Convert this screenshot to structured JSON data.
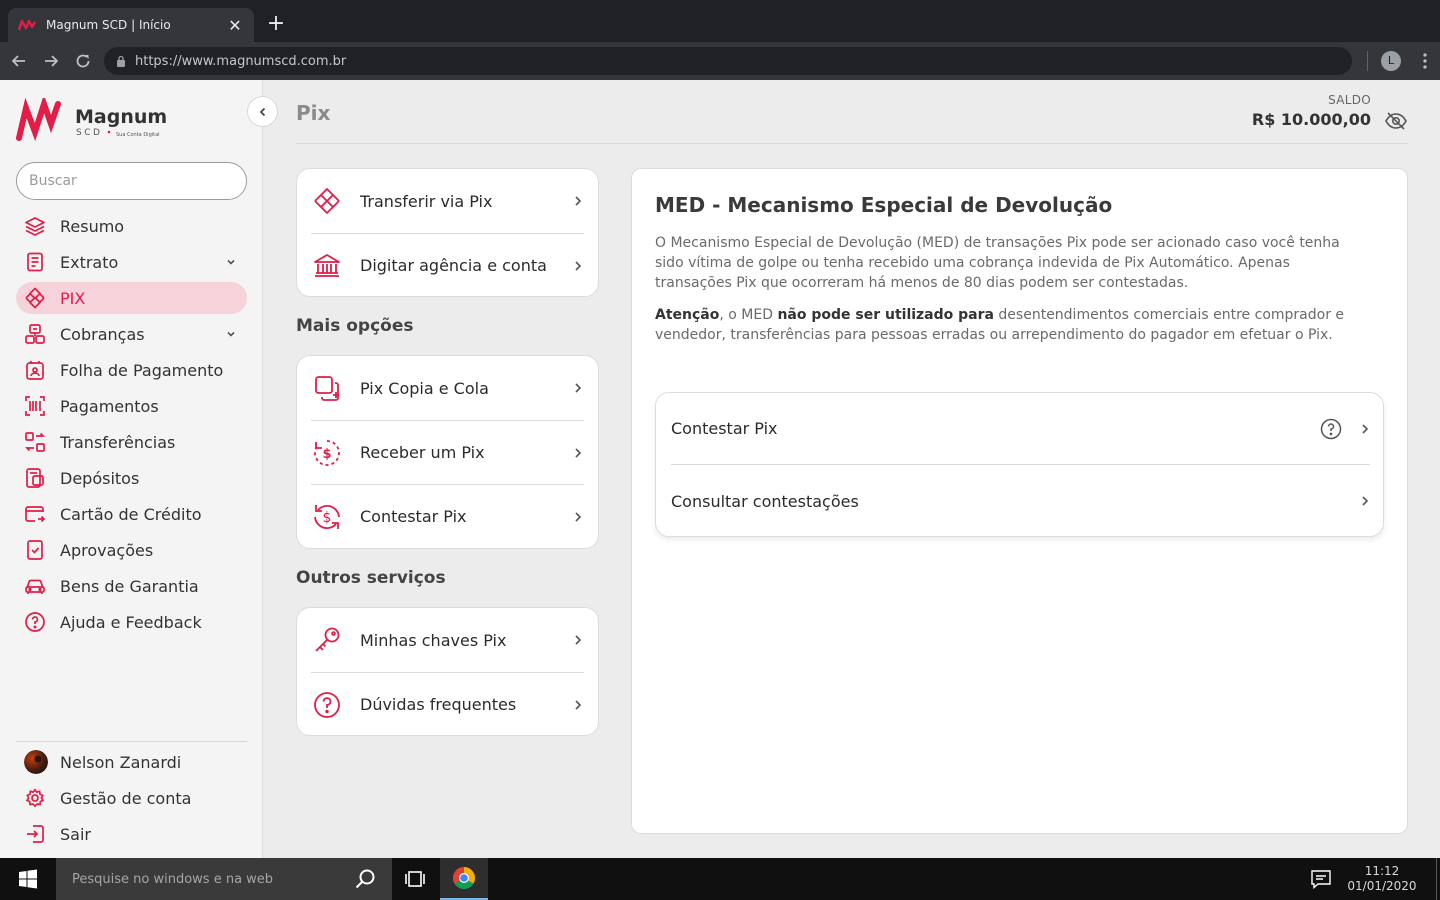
{
  "browser": {
    "tab_title": "Magnum SCD  |  Início",
    "url": "https://www.magnumscd.com.br",
    "profile_initial": "L",
    "new_tab_glyph": "+",
    "close_glyph": "✕"
  },
  "brand": {
    "name": "Magnum",
    "sub": "SCD",
    "tagline": "Sua Conta Digital",
    "accent_color": "#e11d48"
  },
  "sidebar": {
    "search_placeholder": "Buscar",
    "items": [
      {
        "label": "Resumo",
        "icon": "layers-icon"
      },
      {
        "label": "Extrato",
        "icon": "receipt-icon",
        "expandable": true
      },
      {
        "label": "PIX",
        "icon": "pix-icon",
        "active": true
      },
      {
        "label": "Cobranças",
        "icon": "billing-icon",
        "expandable": true
      },
      {
        "label": "Folha de Pagamento",
        "icon": "payroll-icon"
      },
      {
        "label": "Pagamentos",
        "icon": "barcode-icon"
      },
      {
        "label": "Transferências",
        "icon": "transfer-icon"
      },
      {
        "label": "Depósitos",
        "icon": "deposit-icon"
      },
      {
        "label": "Cartão de Crédito",
        "icon": "credit-card-icon"
      },
      {
        "label": "Aprovações",
        "icon": "approval-icon"
      },
      {
        "label": "Bens de Garantia",
        "icon": "car-icon"
      },
      {
        "label": "Ajuda e Feedback",
        "icon": "help-icon"
      }
    ],
    "footer": [
      {
        "label": "Nelson Zanardi",
        "icon": "avatar"
      },
      {
        "label": "Gestão de conta",
        "icon": "gear-icon"
      },
      {
        "label": "Sair",
        "icon": "logout-icon"
      }
    ]
  },
  "main": {
    "page_title": "Pix",
    "balance_label": "SALDO",
    "balance_value": "R$ 10.000,00",
    "cards": {
      "primary": [
        {
          "label": "Transferir via Pix",
          "icon": "pix-icon"
        },
        {
          "label": "Digitar agência e conta",
          "icon": "bank-icon"
        }
      ],
      "mais_opcoes_title": "Mais opções",
      "mais_opcoes": [
        {
          "label": "Pix Copia e Cola",
          "icon": "copy-paste-icon"
        },
        {
          "label": "Receber um Pix",
          "icon": "receive-money-icon"
        },
        {
          "label": "Contestar Pix",
          "icon": "contest-money-icon"
        }
      ],
      "outros_title": "Outros serviços",
      "outros": [
        {
          "label": "Minhas chaves Pix",
          "icon": "key-icon"
        },
        {
          "label": "Dúvidas frequentes",
          "icon": "question-icon"
        }
      ]
    },
    "med": {
      "title": "MED - Mecanismo Especial de Devolução",
      "paragraph1": "O Mecanismo Especial de Devolução (MED) de transações Pix pode ser acionado caso você tenha sido vítima de golpe ou tenha recebido uma cobrança indevida de Pix Automático. Apenas transações Pix que ocorreram há menos de 80 dias podem ser contestadas.",
      "attention_bold": "Atenção",
      "attention_mid": ", o MED ",
      "attention_bold2": "não pode ser utilizado para",
      "attention_rest": " desentendimentos comerciais entre comprador e vendedor, transferências para pessoas erradas ou arrependimento do pagador em efetuar o Pix.",
      "actions": [
        {
          "label": "Contestar Pix",
          "has_help": true
        },
        {
          "label": "Consultar contestações"
        }
      ]
    }
  },
  "taskbar": {
    "search_placeholder": "Pesquise no windows e na web",
    "time": "11:12",
    "date": "01/01/2020"
  }
}
